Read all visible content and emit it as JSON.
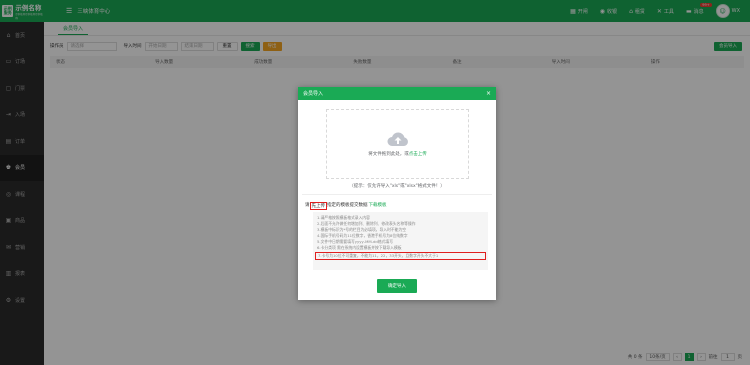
{
  "app": {
    "logo_badge": "示例\n服务",
    "logo_title": "示例名称",
    "logo_sub": "示例名称示例名称示例名称",
    "center_title": "三峡体育中心"
  },
  "topbar": {
    "items": [
      {
        "icon": "grid-icon",
        "label": "开闸"
      },
      {
        "icon": "bell-icon",
        "label": "收银"
      },
      {
        "icon": "home-icon",
        "label": "租赁"
      },
      {
        "icon": "tools-icon",
        "label": "工具"
      },
      {
        "icon": "message-icon",
        "label": "消息",
        "badge": "99+"
      }
    ],
    "user": "WX"
  },
  "sidebar": {
    "items": [
      {
        "icon": "house-icon",
        "label": "首页"
      },
      {
        "icon": "order-icon",
        "label": "订场"
      },
      {
        "icon": "ticket-icon",
        "label": "门票"
      },
      {
        "icon": "entry-icon",
        "label": "入场"
      },
      {
        "icon": "list-icon",
        "label": "订单"
      },
      {
        "icon": "member-icon",
        "label": "会员",
        "active": true
      },
      {
        "icon": "coach-icon",
        "label": "课程"
      },
      {
        "icon": "goods-icon",
        "label": "商品"
      },
      {
        "icon": "marketing-icon",
        "label": "营销"
      },
      {
        "icon": "report-icon",
        "label": "报表"
      },
      {
        "icon": "settings-icon",
        "label": "设置"
      }
    ]
  },
  "main": {
    "tab": "会员导入",
    "filters": {
      "operator_label": "操作员",
      "operator_placeholder": "请选择",
      "time_label": "导入时间",
      "start_placeholder": "开始日期",
      "end_placeholder": "结束日期",
      "reset": "重置",
      "search": "搜索",
      "export": "导出",
      "import": "会员导入"
    },
    "columns": [
      "状态",
      "导入数量",
      "成功数量",
      "失败数量",
      "备注",
      "导入时间",
      "操作"
    ],
    "pager": {
      "total": "共 0 条",
      "page_size": "10条/页",
      "current": "1",
      "goto_label": "前往",
      "goto_value": "1",
      "page_unit": "页"
    }
  },
  "modal": {
    "title": "会员导入",
    "close": "×",
    "upload_hint": "将文件拖到此处，或",
    "upload_link": "点击上传",
    "tip": "（提示：仅允许导入\"xls\"或\"xlsx\"格式文件！）",
    "step_prefix": "请",
    "step_highlight": "先上传",
    "step_middle": "指定的模板提交数据",
    "step_link": "下载模板",
    "rules": [
      "1.请严格按照模板格式录入内容",
      "2.后面不允许做任何增加列、删除列、修改表头名称等操作",
      "3.模板中标识为*号的栏目为必填项，导入时不能为空",
      "4.国际手机号码为11位数字，香港手机号为8位纯数字",
      "5.文件中日期需要填写yyyy-MM-dd格式填写",
      "6.卡分类项 需在系统内设置模板并按下载导入模板",
      "7.卡号为10位不可重复，不能为11，22，33开头，且数字开头不大于1"
    ],
    "confirm": "确定导入"
  }
}
